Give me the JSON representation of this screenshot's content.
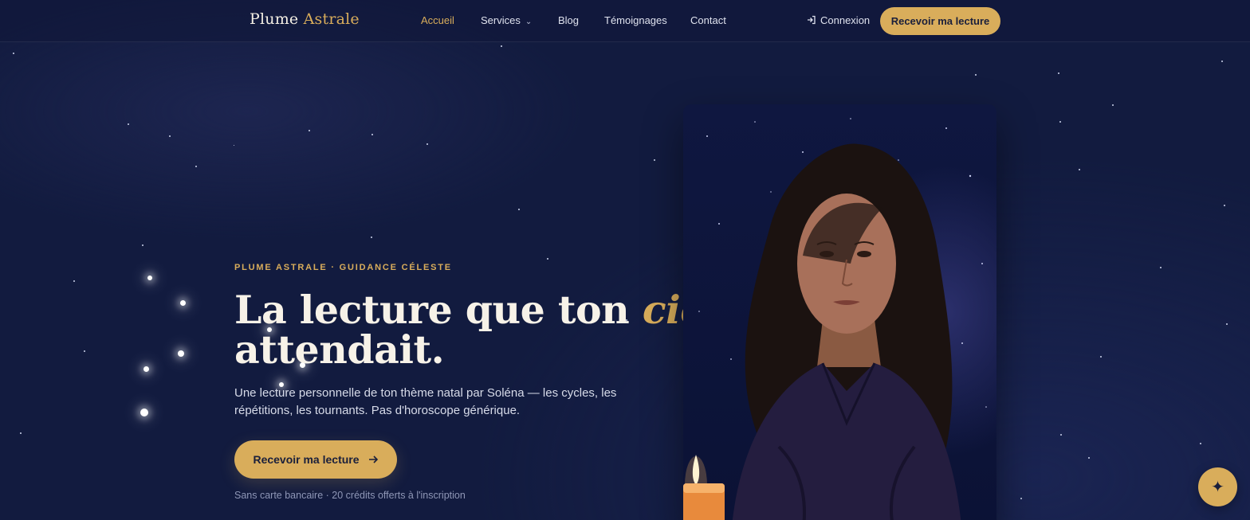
{
  "brand": {
    "name_main": "Plume",
    "name_accent": "Astrale"
  },
  "nav": {
    "items": [
      {
        "label": "Accueil",
        "active": true
      },
      {
        "label": "Services",
        "has_dropdown": true
      },
      {
        "label": "Blog"
      },
      {
        "label": "Témoignages"
      },
      {
        "label": "Contact"
      }
    ],
    "login_label": "Connexion",
    "cta_label": "Recevoir ma lecture"
  },
  "hero": {
    "eyebrow": "PLUME ASTRALE · GUIDANCE CÉLESTE",
    "title_part1": "La lecture que ton",
    "title_accent": "ciel",
    "title_part2": "attendait.",
    "subtitle": "Une lecture personnelle de ton thème natal par Soléna — les cycles, les répétitions, les tournants. Pas d'horoscope générique.",
    "cta_label": "Recevoir ma lecture",
    "note": "Sans carte bancaire · 20 crédits offerts à l'inscription"
  },
  "portrait": {
    "alt": "Soléna"
  },
  "fab": {
    "icon": "sparkle-icon",
    "glyph": "✦"
  },
  "colors": {
    "background": "#121b3f",
    "accent": "#d9ad5b",
    "text": "#f7f2e8"
  }
}
